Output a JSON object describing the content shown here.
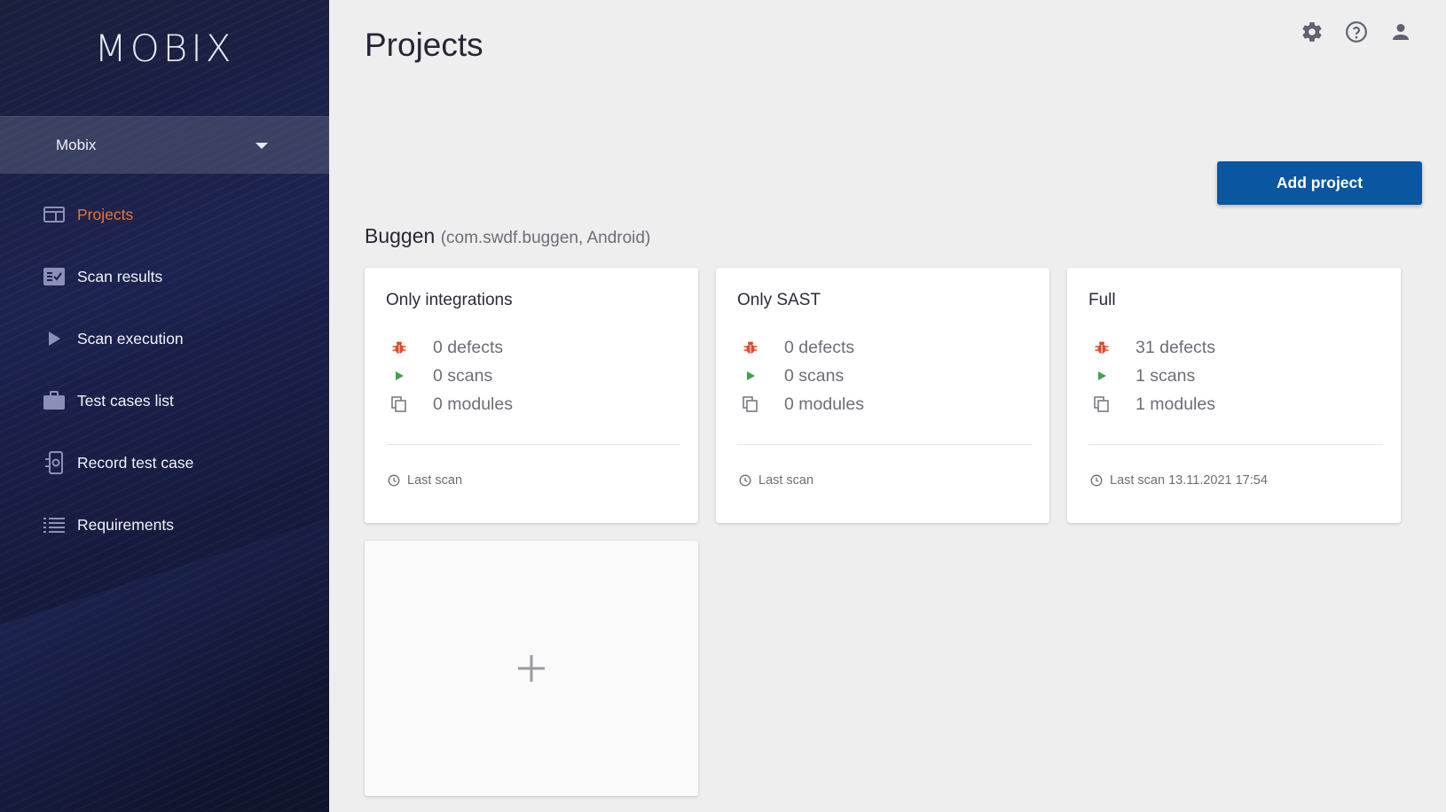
{
  "app": {
    "logo": "MOBIX"
  },
  "workspace": {
    "label": "Mobix"
  },
  "sidebar": {
    "items": [
      {
        "label": "Projects",
        "icon": "dashboard-icon",
        "active": true
      },
      {
        "label": "Scan results",
        "icon": "checklist-icon"
      },
      {
        "label": "Scan execution",
        "icon": "play-icon"
      },
      {
        "label": "Test cases list",
        "icon": "briefcase-icon"
      },
      {
        "label": "Record test case",
        "icon": "phone-settings-icon"
      },
      {
        "label": "Requirements",
        "icon": "list-icon"
      }
    ]
  },
  "header": {
    "title": "Projects",
    "icons": [
      "gear-icon",
      "help-icon",
      "user-icon"
    ]
  },
  "toolbar": {
    "add_project_label": "Add project"
  },
  "project": {
    "name": "Buggen",
    "meta": "(com.swdf.buggen, Android)",
    "cards": [
      {
        "title": "Only integrations",
        "defects": "0 defects",
        "scans": "0 scans",
        "modules": "0 modules",
        "last_scan": "Last scan"
      },
      {
        "title": "Only SAST",
        "defects": "0 defects",
        "scans": "0 scans",
        "modules": "0 modules",
        "last_scan": "Last scan"
      },
      {
        "title": "Full",
        "defects": "31 defects",
        "scans": "1 scans",
        "modules": "1 modules",
        "last_scan": "Last scan 13.11.2021 17:54"
      }
    ]
  },
  "colors": {
    "accent": "#f2722c",
    "primary_button": "#0b56a0",
    "defect": "#e04a2a",
    "scan": "#3fa34d"
  }
}
